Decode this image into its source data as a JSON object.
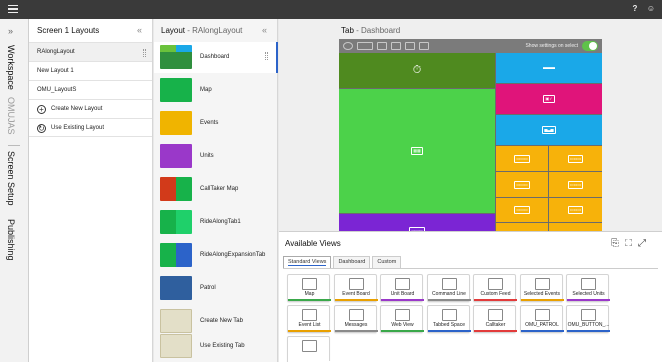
{
  "topbar": {
    "help_icon": "help-icon",
    "user_icon": "user-icon"
  },
  "rail": {
    "items": [
      {
        "label": "Workspace",
        "active": false
      },
      {
        "label": "OMUJAS",
        "active": false
      },
      {
        "label": "Screen Setup",
        "active": true
      },
      {
        "label": "Publishing",
        "active": false
      }
    ]
  },
  "screen_layouts": {
    "title": "Screen 1 Layouts",
    "collapse": "«",
    "rows": [
      "RAlongLayout",
      "New Layout 1",
      "OMU_LayoutS"
    ],
    "actions": [
      {
        "icon": "plus",
        "label": "Create New Layout"
      },
      {
        "icon": "copy",
        "label": "Use Existing Layout"
      }
    ]
  },
  "layout": {
    "title": "Layout",
    "subtitle": " - RAlongLayout",
    "collapse": "«",
    "items": [
      {
        "label": "Dashboard",
        "color": "#2f8f3e",
        "selected": true
      },
      {
        "label": "Map",
        "color": "#17b24a"
      },
      {
        "label": "Events",
        "color": "#f0b400"
      },
      {
        "label": "Units",
        "color": "#9a38c9"
      },
      {
        "label": "CallTaker Map",
        "color": "#d23a1a"
      },
      {
        "label": "RideAlongTab1",
        "color": "#17b24a"
      },
      {
        "label": "RideAlongExpansionTab",
        "color": "#17b24a"
      },
      {
        "label": "Patrol",
        "color": "#2f5f9e"
      },
      {
        "label": "Create New Tab",
        "color": "#d9d3b3"
      },
      {
        "label": "Use Existing Tab",
        "color": "#d9d3b3"
      }
    ]
  },
  "tab": {
    "title": "Tab",
    "subtitle": " - Dashboard",
    "show_settings_label": "Show settings on select",
    "show_settings_on": true
  },
  "available_views": {
    "title": "Available Views",
    "tabs": [
      "Standard Views",
      "Dashboard",
      "Custom"
    ],
    "active_tab": "Standard Views",
    "cards": [
      {
        "label": "Map",
        "bar": "#3aa84a"
      },
      {
        "label": "Event Board",
        "bar": "#e9a000"
      },
      {
        "label": "Unit Board",
        "bar": "#9a38c9"
      },
      {
        "label": "Command Line",
        "bar": "#8a8a8a"
      },
      {
        "label": "Custom Feed",
        "bar": "#e23b3b"
      },
      {
        "label": "Selected Events",
        "bar": "#e9a000"
      },
      {
        "label": "Selected Units",
        "bar": "#9a38c9"
      },
      {
        "label": "Event List",
        "bar": "#e9a000"
      },
      {
        "label": "Messages",
        "bar": "#8a8a8a"
      },
      {
        "label": "Web View",
        "bar": "#3aa84a"
      },
      {
        "label": "Tabbed Space",
        "bar": "#2c63c9"
      },
      {
        "label": "Calltaker",
        "bar": "#e23b3b"
      },
      {
        "label": "OMU_PATROL",
        "bar": "#2c63c9"
      },
      {
        "label": "OMU_BUTTON_...",
        "bar": "#2c63c9"
      },
      {
        "label": "",
        "bar": "#ffffff"
      }
    ]
  },
  "colors": {
    "green": "#4cd24a",
    "dark_green": "#4f8a1f",
    "cyan": "#1aa8e8",
    "magenta": "#e0147a",
    "amber": "#f7b20a",
    "purple": "#7b25d4",
    "accent": "#2c63c9"
  }
}
